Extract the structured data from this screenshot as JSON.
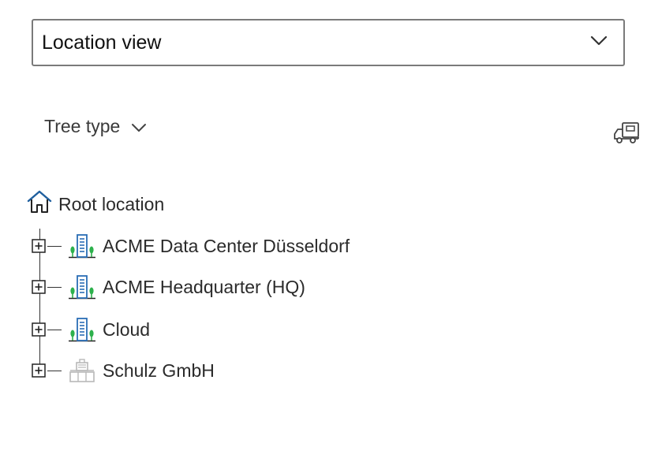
{
  "view_selector": {
    "value": "Location view",
    "icon": "chevron-down-icon"
  },
  "tree_type": {
    "label": "Tree type",
    "icon": "chevron-down-icon"
  },
  "toolbar": {
    "truck_icon": "truck-icon"
  },
  "tree": {
    "root": {
      "label": "Root location",
      "icon": "home-icon",
      "icon_color": "#1f5f9e"
    },
    "nodes": [
      {
        "label": "ACME Data Center Düsseldorf",
        "icon": "building-icon"
      },
      {
        "label": "ACME Headquarter (HQ)",
        "icon": "building-icon"
      },
      {
        "label": "Cloud",
        "icon": "building-icon"
      },
      {
        "label": "Schulz GmbH",
        "icon": "company-icon"
      }
    ]
  },
  "colors": {
    "building_blue": "#2a6db5",
    "tree_green": "#2db14c",
    "company_gray": "#b8b8b8"
  }
}
